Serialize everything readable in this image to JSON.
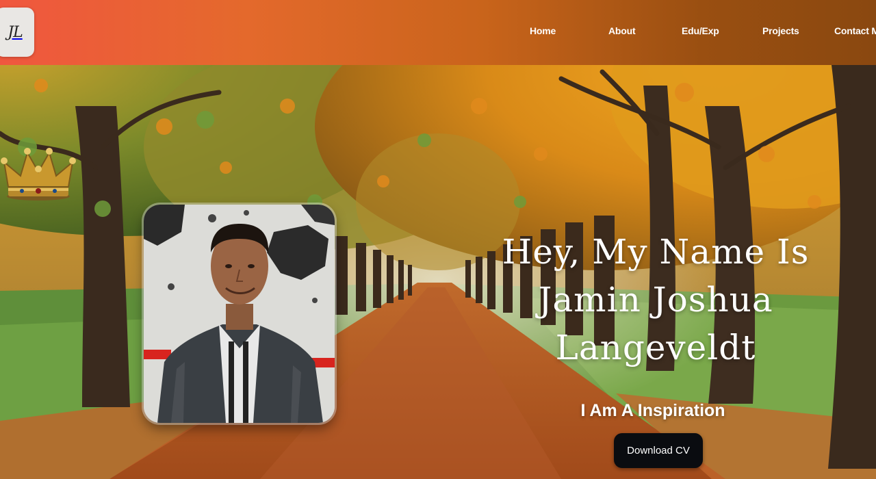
{
  "logo": {
    "text": "JL"
  },
  "nav": {
    "items": [
      "Home",
      "About",
      "Edu/Exp",
      "Projects",
      "Contact Me"
    ]
  },
  "hero": {
    "headline_line1": "Hey, My Name Is",
    "headline_line2": "Jamin Joshua",
    "headline_line3": "Langeveldt",
    "tagline": "I Am A Inspiration",
    "cta_label": "Download CV"
  },
  "colors": {
    "header_start": "#f0573f",
    "header_end": "#8a4810",
    "button_bg": "#0a0c10",
    "text": "#ffffff"
  },
  "icons": [
    "crown-icon"
  ]
}
